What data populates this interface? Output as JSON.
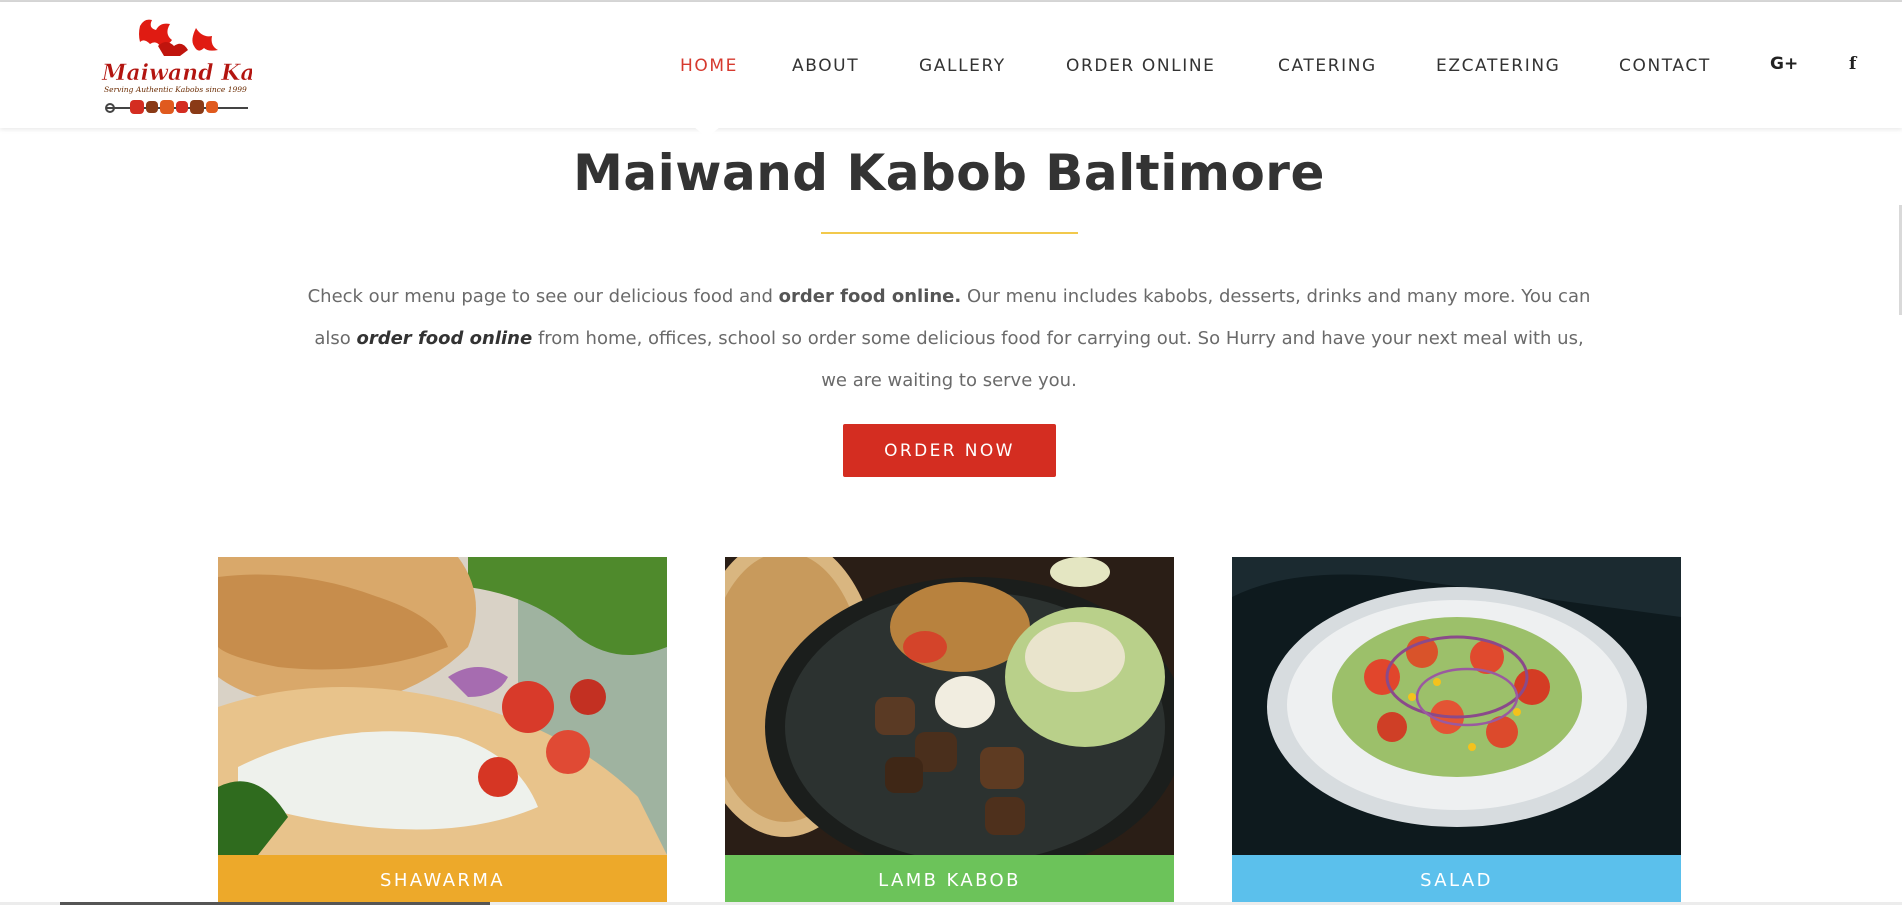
{
  "brand": {
    "logo_text": "Maiwand Kabob",
    "logo_tagline": "Serving Authentic Kabobs since 1999",
    "accent_color": "#d42d21",
    "divider_color": "#f2c94c"
  },
  "nav": {
    "items": [
      {
        "label": "HOME",
        "active": true
      },
      {
        "label": "ABOUT",
        "active": false
      },
      {
        "label": "GALLERY",
        "active": false
      },
      {
        "label": "ORDER ONLINE",
        "active": false
      },
      {
        "label": "CATERING",
        "active": false
      },
      {
        "label": "EZCATERING",
        "active": false
      },
      {
        "label": "CONTACT",
        "active": false
      }
    ],
    "social": [
      {
        "icon": "google-plus-icon",
        "glyph": "G+"
      },
      {
        "icon": "facebook-icon",
        "glyph": "f"
      }
    ]
  },
  "hero": {
    "title": "Maiwand Kabob Baltimore",
    "intro": {
      "part1": "Check our menu page to see our delicious food and ",
      "bold1": "order food online.",
      "part2": " Our menu includes kabobs, desserts, drinks and many more. You can also ",
      "bold2": "order food online",
      "part3": " from home, offices, school so order some delicious food for carrying out. So Hurry and have your next meal with us, we are waiting to serve you."
    },
    "button_label": "ORDER NOW"
  },
  "cards": [
    {
      "label": "SHAWARMA",
      "color": "#eda92a"
    },
    {
      "label": "LAMB KABOB",
      "color": "#6cc35a"
    },
    {
      "label": "SALAD",
      "color": "#5bc0ec"
    }
  ]
}
